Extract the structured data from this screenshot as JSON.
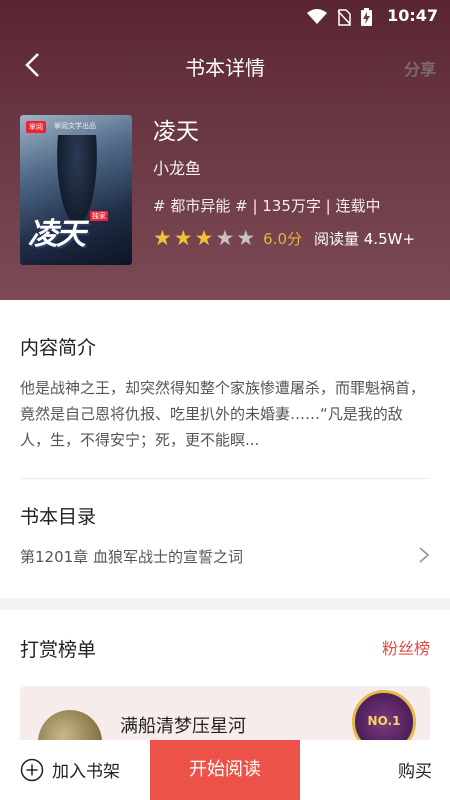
{
  "status_bar": {
    "time": "10:47"
  },
  "header": {
    "title": "书本详情",
    "share": "分享"
  },
  "cover": {
    "badge": "掌阅",
    "subtitle": "掌阅文学出品",
    "title": "凌天",
    "tag": "独家"
  },
  "book": {
    "title": "凌天",
    "author": "小龙鱼",
    "meta": "# 都市异能 # | 135万字 | 连载中",
    "stars_filled": 3,
    "stars_total": 5,
    "score": "6.0分",
    "reads": "阅读量 4.5W+"
  },
  "synopsis": {
    "heading": "内容简介",
    "text": "他是战神之王，却突然得知整个家族惨遭屠杀，而罪魁祸首，竟然是自己恩将仇报、吃里扒外的未婚妻……“凡是我的敌人，生，不得安宁；死，更不能瞑..."
  },
  "catalog": {
    "heading": "书本目录",
    "latest_chapter": "第1201章 血狼军战士的宣誓之词"
  },
  "rewards": {
    "heading": "打赏榜单",
    "fans_link": "粉丝榜",
    "top_name": "满船清梦压星河",
    "rank_label": "NO.1"
  },
  "bottom_bar": {
    "add_shelf": "加入书架",
    "start_reading": "开始阅读",
    "buy": "购买"
  },
  "colors": {
    "hero_top": "#5a2533",
    "accent_red": "#ec5247",
    "star_gold": "#f0c23c",
    "star_empty": "#c9c2c4"
  }
}
